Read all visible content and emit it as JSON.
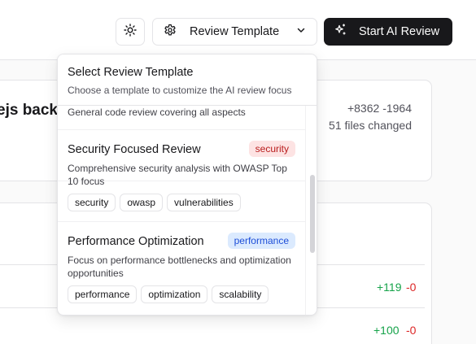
{
  "toolbar": {
    "template_label": "Review Template",
    "start_label": "Start AI Review"
  },
  "pr": {
    "title_fragment": "ejs back",
    "additions": "+8362",
    "deletions": "-1964",
    "files_changed": "51 files changed"
  },
  "file_rows": [
    {
      "additions": "+119",
      "deletions": "-0"
    },
    {
      "additions": "+100",
      "deletions": "-0"
    }
  ],
  "dropdown": {
    "title": "Select Review Template",
    "subtitle": "Choose a template to customize the AI review focus",
    "partial_item_desc": "General code review covering all aspects",
    "items": [
      {
        "name": "Security Focused Review",
        "badge": "security",
        "description": "Comprehensive security analysis with OWASP Top 10 focus",
        "tags": [
          "security",
          "owasp",
          "vulnerabilities"
        ]
      },
      {
        "name": "Performance Optimization",
        "badge": "performance",
        "description": "Focus on performance bottlenecks and optimization opportunities",
        "tags": [
          "performance",
          "optimization",
          "scalability"
        ]
      }
    ]
  },
  "colors": {
    "primary": "#18181b",
    "security_badge_bg": "#fde3e3",
    "security_badge_text": "#b91c1c",
    "performance_badge_bg": "#dbeafe",
    "performance_badge_text": "#1d4ed8",
    "additions": "#16a34a",
    "deletions": "#dc2626"
  },
  "icons": {
    "theme": "sun-icon",
    "template": "gear-icon",
    "template_chevron": "chevron-down-icon",
    "start": "sparkles-icon"
  }
}
